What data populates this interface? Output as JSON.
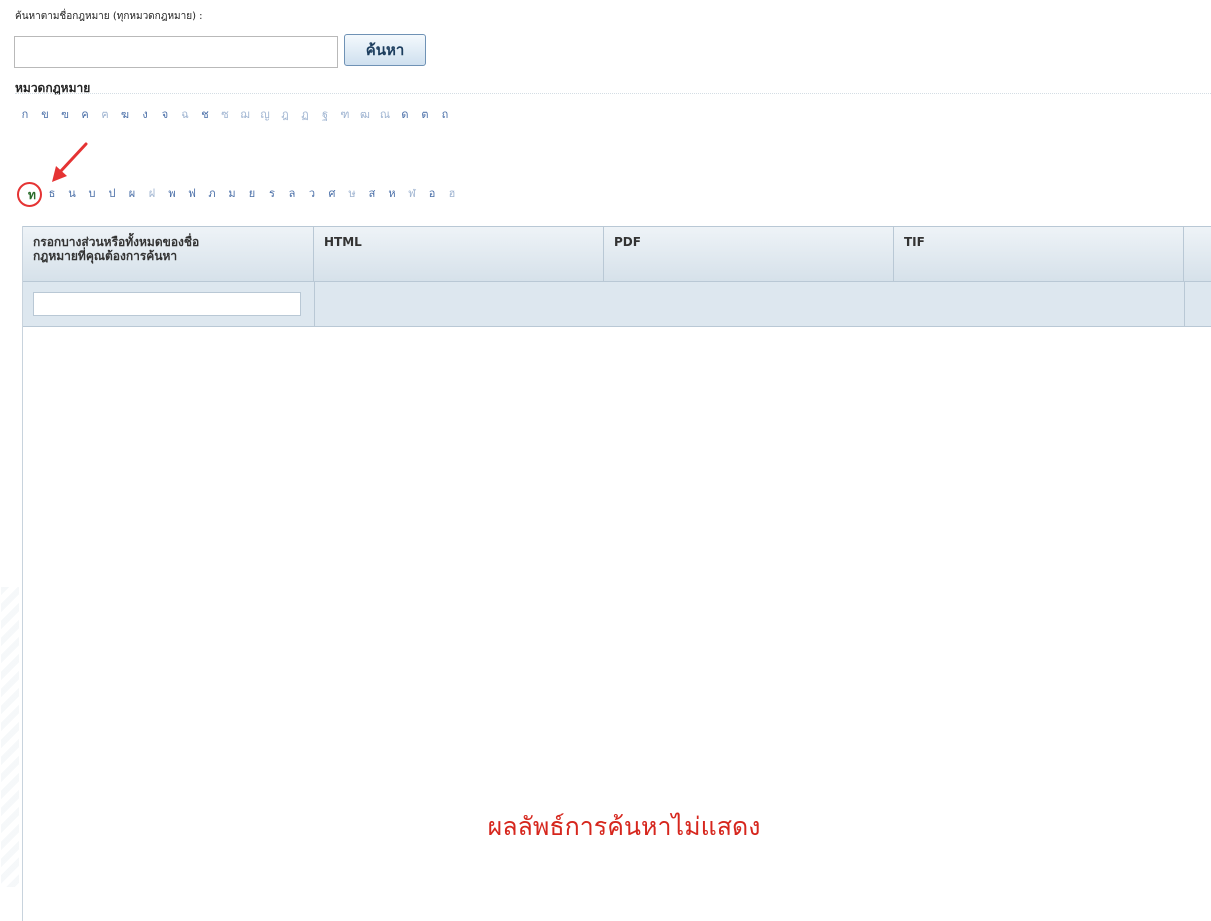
{
  "search": {
    "label": "ค้นหาตามชื่อกฎหมาย (ทุกหมวดกฎหมาย) :",
    "value": "",
    "button_label": "ค้นหา"
  },
  "categories": {
    "heading": "หมวดกฎหมาย",
    "row1": [
      "ก",
      "ข",
      "ฃ",
      "ค",
      "ฅ",
      "ฆ",
      "ง",
      "จ",
      "ฉ",
      "ช",
      "ซ",
      "ฌ",
      "ญ",
      "ฎ",
      "ฏ",
      "ฐ",
      "ฑ",
      "ฒ",
      "ณ",
      "ด",
      "ต",
      "ถ"
    ],
    "selected": "ท",
    "row2": [
      "ธ",
      "น",
      "บ",
      "ป",
      "ผ",
      "ฝ",
      "พ",
      "ฟ",
      "ภ",
      "ม",
      "ย",
      "ร",
      "ล",
      "ว",
      "ศ",
      "ษ",
      "ส",
      "ห",
      "ฬ",
      "อ",
      "ฮ"
    ]
  },
  "table": {
    "columns": [
      "กรอกบางส่วนหรือทั้งหมดของชื่อ\nกฎหมายที่คุณต้องการค้นหา",
      "HTML",
      "PDF",
      "TIF"
    ],
    "filter_value": ""
  },
  "annotation": {
    "no_results": "ผลลัพธ์การค้นหาไม่แสดง",
    "color": "#d6261d"
  }
}
